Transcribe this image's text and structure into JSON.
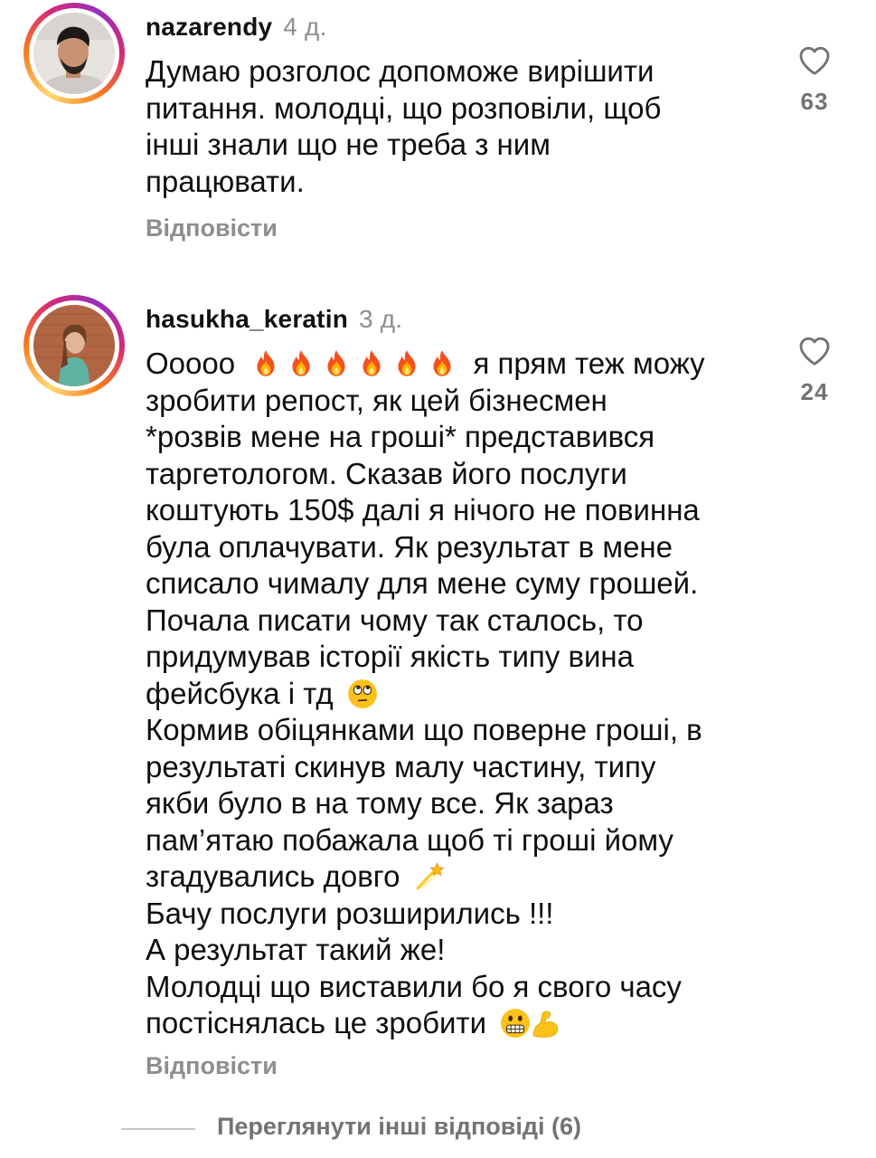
{
  "comments": [
    {
      "username": "nazarendy",
      "time": "4 д.",
      "lines": [
        "Думаю розголос допоможе вирішити",
        "питання. молодці, що розповіли, щоб",
        "інші знали що не треба з ним",
        "працювати."
      ],
      "likes": "63",
      "reply_label": "Відповісти"
    },
    {
      "username": "hasukha_keratin",
      "time": "3 д.",
      "line1_prefix": "Ооооо",
      "line1_suffix": "я прям теж можу",
      "lines": [
        "зробити репост, як цей бізнесмен",
        "*розвів мене на гроші* представився",
        "таргетологом. Сказав його послуги",
        "коштують 150$ далі я нічого не повинна",
        "була оплачувати. Як результат в мене",
        "списало чималу для мене суму грошей.",
        "Почала писати чому так сталось, то",
        "придумував історії якість типу вина",
        "фейсбука і тд",
        "Кормив обіцянками що поверне гроші, в",
        "результаті скинув малу частину, типу",
        "якби було в на тому все. Як зараз",
        "пам’ятаю побажала щоб ті гроші йому",
        "згадувались довго",
        "Бачу послуги розширились !!!",
        "А результат такий же!",
        "Молодці що виставили бо я свого часу",
        "постіснялась це зробити"
      ],
      "emoji": {
        "fire": "fire-emoji",
        "eye_roll": "eye-roll-emoji",
        "dizzy": "dizzy-emoji",
        "grimace": "grimacing-emoji",
        "muscle": "flexed-biceps-emoji"
      },
      "likes": "24",
      "reply_label": "Відповісти"
    }
  ],
  "more_replies_label": "Переглянути інші відповіді (6)",
  "colors": {
    "text": "#0f0f0f",
    "secondary": "#8e8e8e",
    "ring_gradient": [
      "#feda75",
      "#fa7e1e",
      "#d62976",
      "#962fbf"
    ]
  },
  "icons": {
    "like": "heart-outline-icon"
  }
}
